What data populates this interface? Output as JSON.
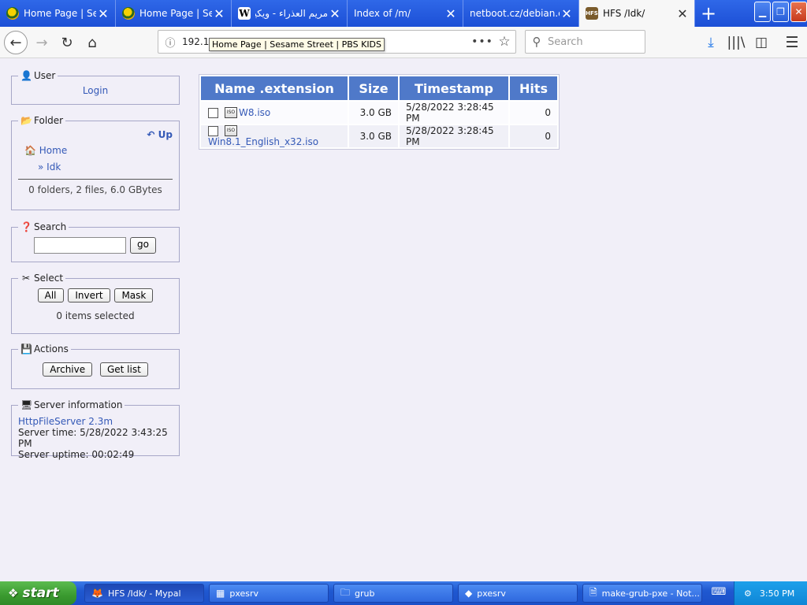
{
  "browser": {
    "tabs": [
      {
        "title": "Home Page | Sesa",
        "icon": "sesame-street-icon",
        "active": false
      },
      {
        "title": "Home Page | Sesa",
        "icon": "sesame-street-icon",
        "active": false
      },
      {
        "title": "مريم العذراء - ويكيـ",
        "icon": "wikipedia-icon",
        "active": false
      },
      {
        "title": "Index of /m/",
        "icon": "",
        "active": false
      },
      {
        "title": "netboot.cz/debian.com",
        "icon": "",
        "active": false
      },
      {
        "title": "HFS /Idk/",
        "icon": "hfs-icon",
        "active": true
      }
    ],
    "url": "192.1",
    "tooltip": "Home Page | Sesame Street | PBS KIDS",
    "search_placeholder": "Search"
  },
  "sidebar": {
    "user": {
      "legend": "User",
      "login": "Login"
    },
    "folder": {
      "legend": "Folder",
      "up": "Up",
      "home": "Home",
      "current": "» Idk",
      "summary": "0 folders, 2 files, 6.0 GBytes"
    },
    "search": {
      "legend": "Search",
      "go": "go"
    },
    "select": {
      "legend": "Select",
      "all": "All",
      "invert": "Invert",
      "mask": "Mask",
      "status": "0 items selected"
    },
    "actions": {
      "legend": "Actions",
      "archive": "Archive",
      "get_list": "Get list"
    },
    "server": {
      "legend": "Server information",
      "version": "HttpFileServer 2.3m",
      "time": "Server time: 5/28/2022 3:43:25 PM",
      "uptime": "Server uptime: 00:02:49"
    }
  },
  "files": {
    "headers": {
      "name": "Name .extension",
      "size": "Size",
      "timestamp": "Timestamp",
      "hits": "Hits"
    },
    "rows": [
      {
        "name": "W8.iso",
        "size": "3.0 GB",
        "timestamp": "5/28/2022 3:28:45 PM",
        "hits": "0"
      },
      {
        "name": "Win8.1_English_x32.iso",
        "size": "3.0 GB",
        "timestamp": "5/28/2022 3:28:45 PM",
        "hits": "0"
      }
    ]
  },
  "taskbar": {
    "start": "start",
    "items": [
      {
        "label": "HFS /Idk/ - Mypal",
        "active": true
      },
      {
        "label": "pxesrv",
        "active": false
      },
      {
        "label": "grub",
        "active": false
      },
      {
        "label": "pxesrv",
        "active": false
      },
      {
        "label": "make-grub-pxe - Not...",
        "active": false
      }
    ],
    "clock": "3:50 PM"
  },
  "colors": {
    "titlebar": "#2f68e8",
    "table_header": "#4f79c9",
    "link": "#3459b7",
    "page_bg": "#f1eff8",
    "start_green": "#3a9a2f"
  }
}
